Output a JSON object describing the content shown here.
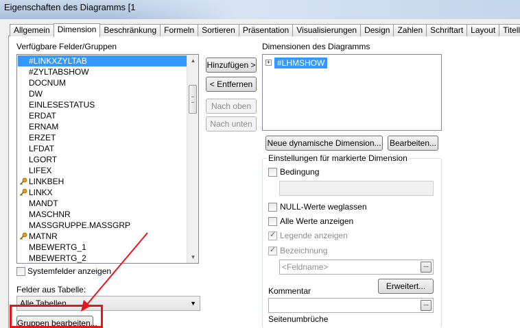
{
  "window": {
    "title": "Eigenschaften des Diagramms [1"
  },
  "tabs": [
    "Allgemein",
    "Dimension",
    "Beschränkung",
    "Formeln",
    "Sortieren",
    "Präsentation",
    "Visualisierungen",
    "Design",
    "Zahlen",
    "Schriftart",
    "Layout",
    "Titelleiste"
  ],
  "active_tab": "Dimension",
  "left": {
    "fields_label": "Verfügbare Felder/Gruppen",
    "fields": [
      {
        "label": "#LINKXZYLTAB",
        "selected": true,
        "icon": ""
      },
      {
        "label": "#ZYLTABSHOW",
        "icon": ""
      },
      {
        "label": "DOCNUM",
        "icon": ""
      },
      {
        "label": "DW",
        "icon": ""
      },
      {
        "label": "EINLESESTATUS",
        "icon": ""
      },
      {
        "label": "ERDAT",
        "icon": ""
      },
      {
        "label": "ERNAM",
        "icon": ""
      },
      {
        "label": "ERZET",
        "icon": ""
      },
      {
        "label": "LFDAT",
        "icon": ""
      },
      {
        "label": "LGORT",
        "icon": ""
      },
      {
        "label": "LIFEX",
        "icon": ""
      },
      {
        "label": "LINKBEH",
        "icon": "key-icon"
      },
      {
        "label": "LINKX",
        "icon": "key-icon"
      },
      {
        "label": "MANDT",
        "icon": ""
      },
      {
        "label": "MASCHNR",
        "icon": ""
      },
      {
        "label": "MASSGRUPPE.MASSGRP",
        "icon": ""
      },
      {
        "label": "MATNR",
        "icon": "key-icon"
      },
      {
        "label": "MBEWERTG_1",
        "icon": ""
      },
      {
        "label": "MBEWERTG_2",
        "icon": ""
      }
    ],
    "system_fields_label": "Systemfelder anzeigen",
    "table_label": "Felder aus Tabelle:",
    "table_select": "Alle Tabellen",
    "edit_groups_button": "Gruppen bearbeiten..."
  },
  "middle": {
    "add_button": "Hinzufügen >",
    "remove_button": "< Entfernen",
    "up_button": "Nach oben",
    "down_button": "Nach unten"
  },
  "right": {
    "dimensions_label": "Dimensionen des Diagramms",
    "dimensions": [
      "#LHMSHOW"
    ],
    "new_dynamic_button": "Neue dynamische Dimension...",
    "edit_button": "Bearbeiten...",
    "settings_label": "Einstellungen für markierte Dimension",
    "condition_label": "Bedingung",
    "suppress_null_label": "NULL-Werte weglassen",
    "show_all_label": "Alle Werte anzeigen",
    "show_legend_label": "Legende anzeigen",
    "label_label": "Bezeichnung",
    "fieldname_placeholder": "<Feldname>",
    "advanced_button": "Erweitert...",
    "comment_label": "Kommentar",
    "page_breaks_label": "Seitenumbrüche"
  },
  "colors": {
    "selection": "#3399ff",
    "highlight": "#e8141a"
  }
}
